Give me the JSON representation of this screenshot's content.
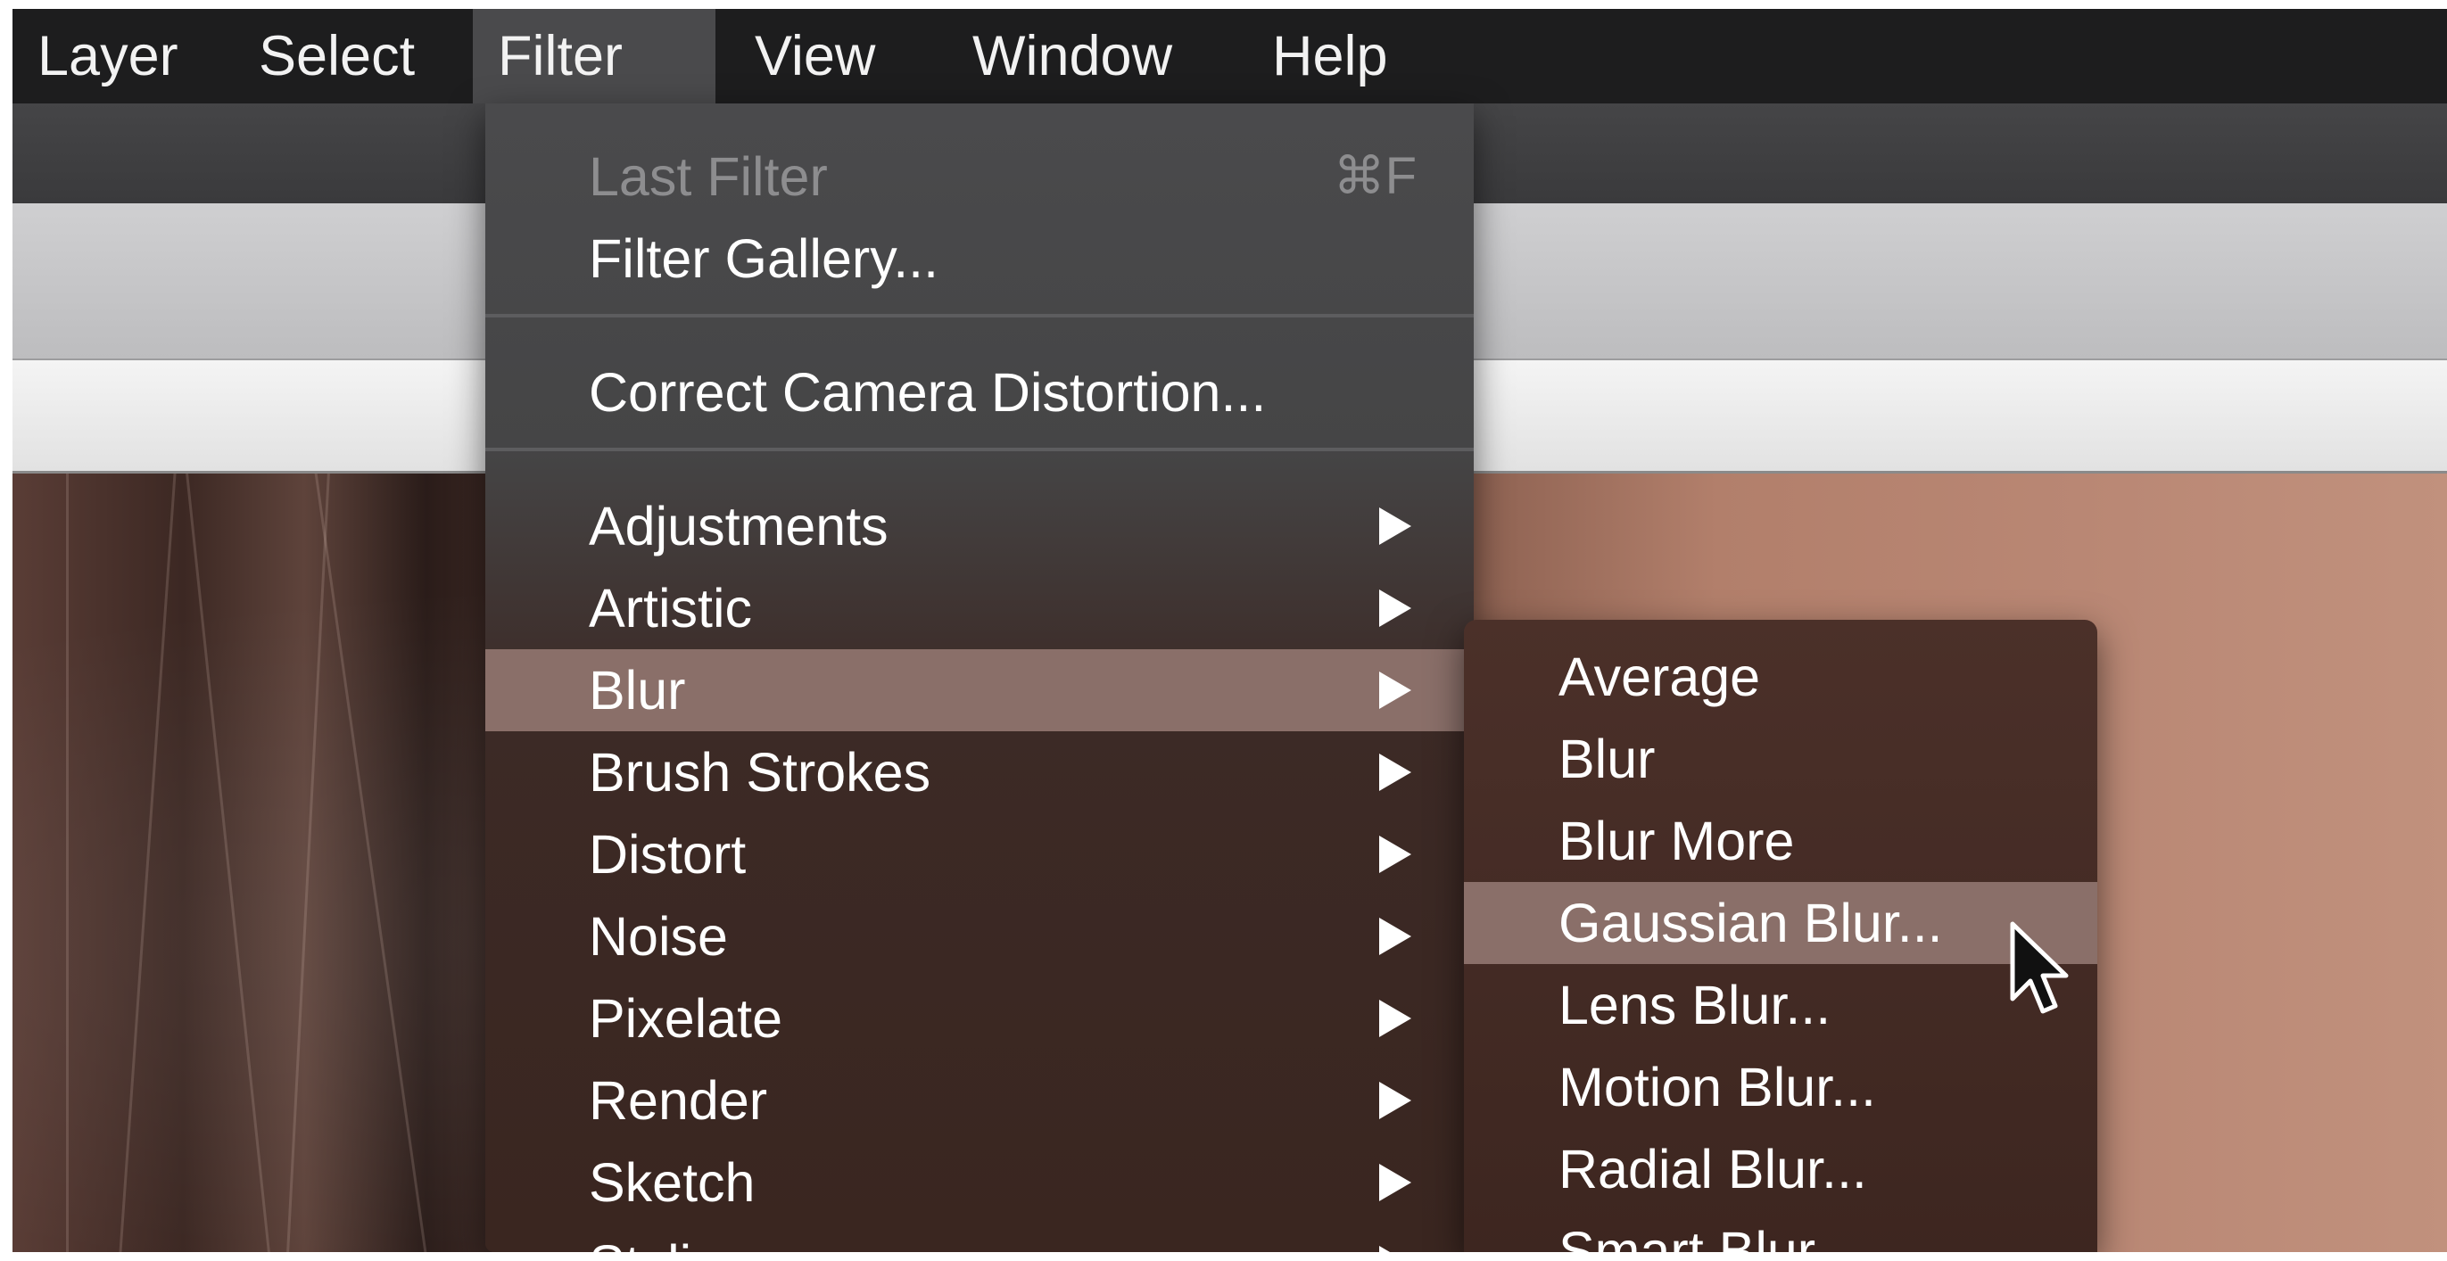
{
  "menubar": {
    "items": [
      {
        "label": "Layer",
        "active": false
      },
      {
        "label": "Select",
        "active": false
      },
      {
        "label": "Filter",
        "active": true
      },
      {
        "label": "View",
        "active": false
      },
      {
        "label": "Window",
        "active": false
      },
      {
        "label": "Help",
        "active": false
      }
    ]
  },
  "filter_menu": {
    "top_items": [
      {
        "label": "Last Filter",
        "shortcut": "⌘F",
        "disabled": true
      },
      {
        "label": "Filter Gallery...",
        "disabled": false
      }
    ],
    "middle_items": [
      {
        "label": "Correct Camera Distortion...",
        "disabled": false
      }
    ],
    "submenu_items": [
      {
        "label": "Adjustments",
        "has_submenu": true
      },
      {
        "label": "Artistic",
        "has_submenu": true
      },
      {
        "label": "Blur",
        "has_submenu": true,
        "highlighted": true
      },
      {
        "label": "Brush Strokes",
        "has_submenu": true
      },
      {
        "label": "Distort",
        "has_submenu": true
      },
      {
        "label": "Noise",
        "has_submenu": true
      },
      {
        "label": "Pixelate",
        "has_submenu": true
      },
      {
        "label": "Render",
        "has_submenu": true
      },
      {
        "label": "Sketch",
        "has_submenu": true
      },
      {
        "label": "Stylize",
        "has_submenu": true
      }
    ]
  },
  "blur_submenu": {
    "items": [
      {
        "label": "Average",
        "highlighted": false
      },
      {
        "label": "Blur",
        "highlighted": false
      },
      {
        "label": "Blur More",
        "highlighted": false
      },
      {
        "label": "Gaussian Blur...",
        "highlighted": true
      },
      {
        "label": "Lens Blur...",
        "highlighted": false
      },
      {
        "label": "Motion Blur...",
        "highlighted": false
      },
      {
        "label": "Radial Blur...",
        "highlighted": false
      },
      {
        "label": "Smart Blur...",
        "highlighted": false
      }
    ]
  },
  "colors": {
    "menubar_bg": "#1d1d1e",
    "highlight": "#8a6f69",
    "menu_text": "#ffffff",
    "disabled_text": "#8d8d8f"
  },
  "icons": {
    "cursor": "mouse-pointer-icon",
    "submenu_arrow": "submenu-arrow-icon",
    "shortcut_modifier": "command-key-icon"
  }
}
